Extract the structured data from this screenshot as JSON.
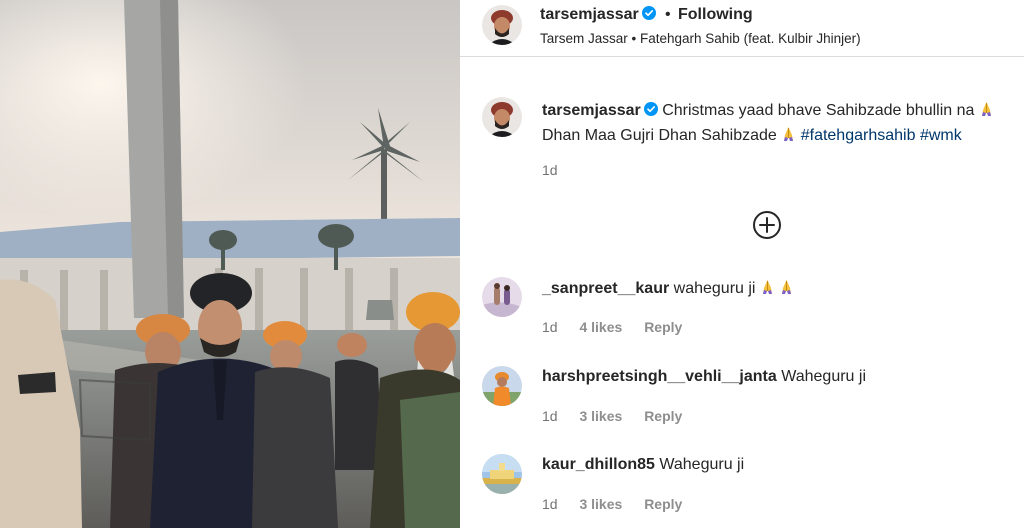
{
  "post": {
    "username": "tarsemjassar",
    "separator": "•",
    "follow_label": "Following",
    "audio": "Tarsem Jassar • Fatehgarh Sahib (feat. Kulbir Jhinjer)"
  },
  "caption": {
    "username": "tarsemjassar",
    "text_1": "Christmas yaad bhave Sahibzade bhullin na",
    "text_2": "Dhan Maa Gujri Dhan Sahibzade",
    "hashtag_1": "#fatehgarhsahib",
    "hashtag_2": "#wmk",
    "time": "1d"
  },
  "more_comments_icon": "plus-circle-icon",
  "comments": [
    {
      "username": "_sanpreet__kaur",
      "text": "waheguru ji",
      "time": "1d",
      "likes": "4 likes",
      "reply": "Reply"
    },
    {
      "username": "harshpreetsingh__vehli__janta",
      "text": "Waheguru ji",
      "time": "1d",
      "likes": "3 likes",
      "reply": "Reply"
    },
    {
      "username": "kaur_dhillon85",
      "text": "Waheguru ji",
      "time": "1d",
      "likes": "3 likes",
      "reply": "Reply"
    }
  ],
  "colors": {
    "verified": "#0095f6",
    "hashtag": "#00376b",
    "secondary_text": "#737373"
  }
}
